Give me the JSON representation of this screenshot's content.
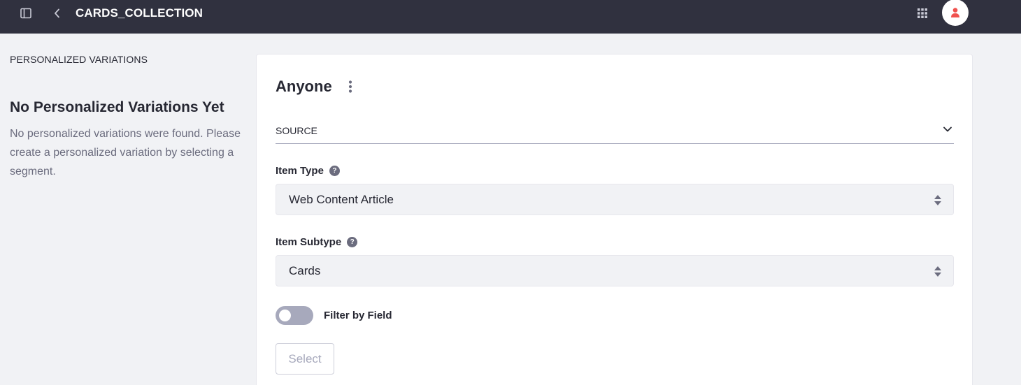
{
  "topbar": {
    "title": "CARDS_COLLECTION",
    "icons": {
      "sidebar_toggle": "sidebar-toggle-icon",
      "back": "chevron-left-icon",
      "apps": "apps-grid-icon",
      "avatar": "user-icon"
    },
    "colors": {
      "background": "#30313f",
      "avatar_accent": "#f0524f"
    }
  },
  "left_panel": {
    "section_label": "PERSONALIZED VARIATIONS",
    "empty_title": "No Personalized Variations Yet",
    "empty_description": "No personalized variations were found. Please create a personalized variation by selecting a segment."
  },
  "card": {
    "heading": "Anyone",
    "source_label": "SOURCE",
    "item_type": {
      "label": "Item Type",
      "value": "Web Content Article"
    },
    "item_subtype": {
      "label": "Item Subtype",
      "value": "Cards"
    },
    "filter_toggle": {
      "label": "Filter by Field",
      "on": false
    },
    "select_button": "Select",
    "help_glyph": "?"
  }
}
